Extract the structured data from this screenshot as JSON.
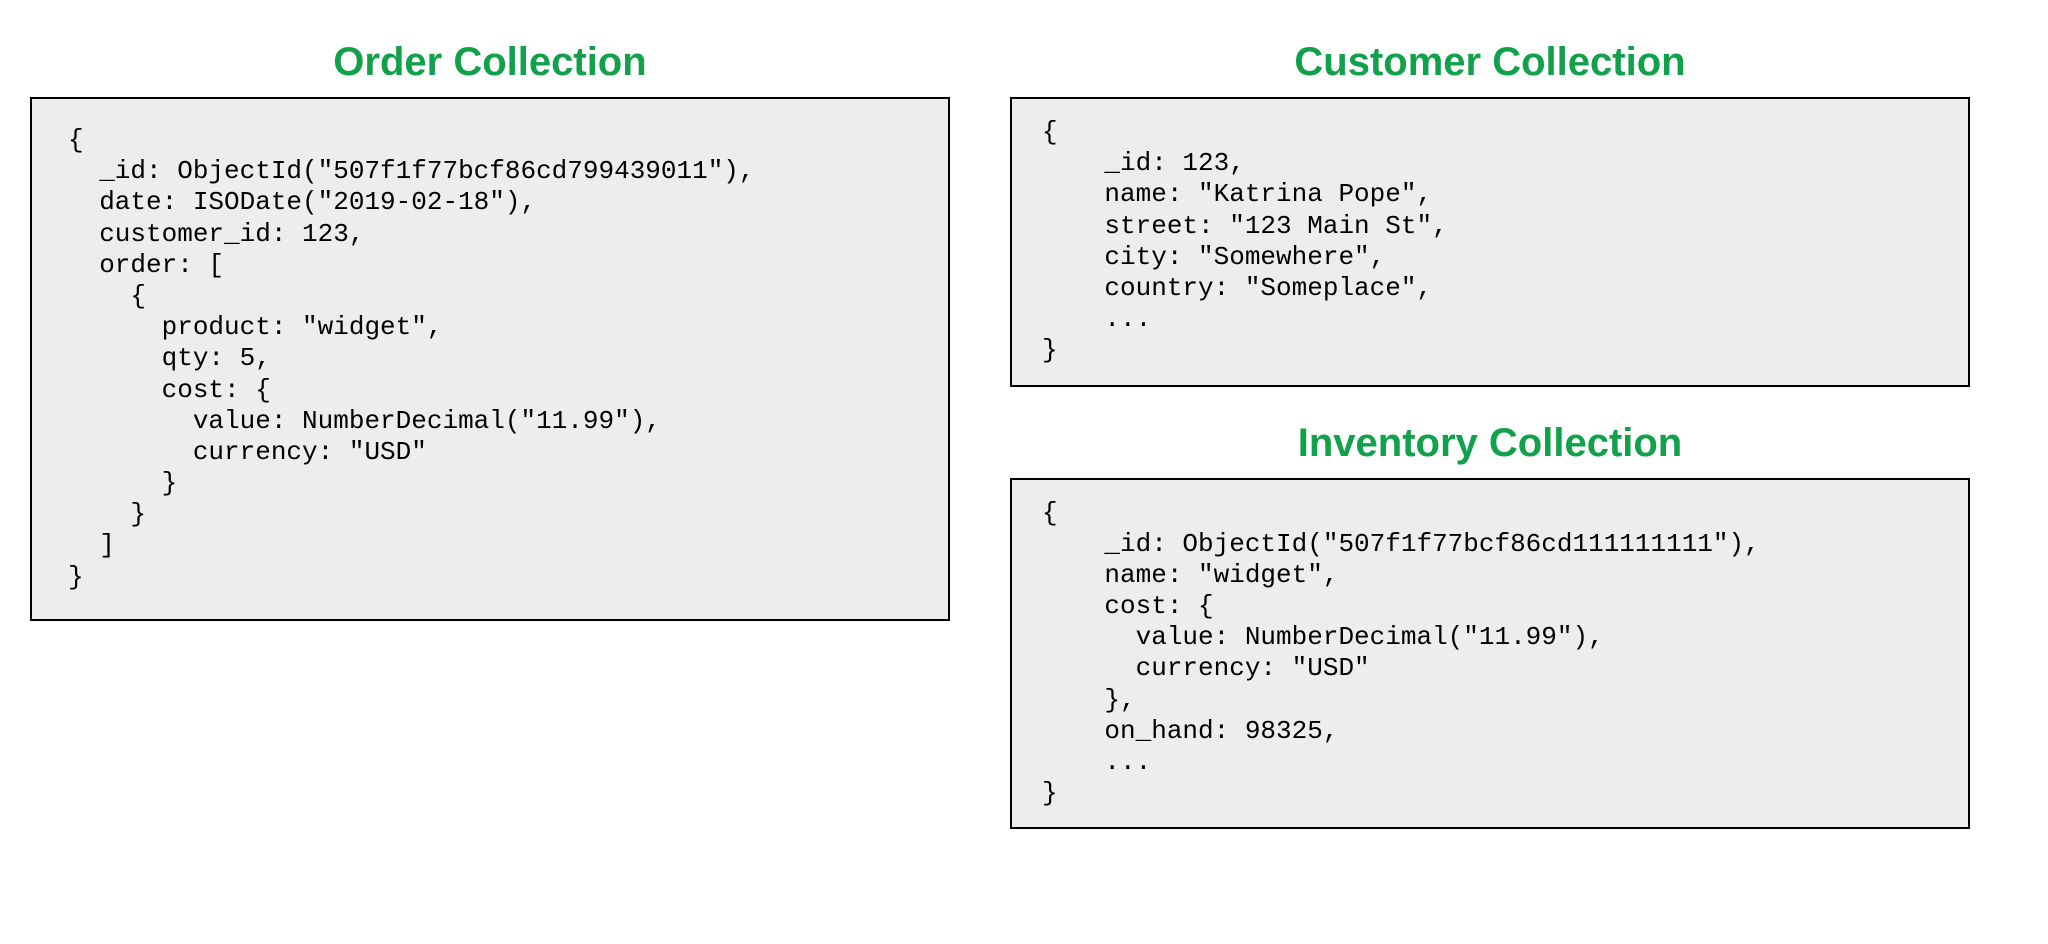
{
  "left": {
    "title": "Order Collection",
    "code": "{\n  _id: ObjectId(\"507f1f77bcf86cd799439011\"),\n  date: ISODate(\"2019-02-18\"),\n  customer_id: 123,\n  order: [\n    {\n      product: \"widget\",\n      qty: 5,\n      cost: {\n        value: NumberDecimal(\"11.99\"),\n        currency: \"USD\"\n      }\n    }\n  ]\n}"
  },
  "right": {
    "customer": {
      "title": "Customer Collection",
      "code": "{\n    _id: 123,\n    name: \"Katrina Pope\",\n    street: \"123 Main St\",\n    city: \"Somewhere\",\n    country: \"Someplace\",\n    ...\n}"
    },
    "inventory": {
      "title": "Inventory Collection",
      "code": "{\n    _id: ObjectId(\"507f1f77bcf86cd111111111\"),\n    name: \"widget\",\n    cost: {\n      value: NumberDecimal(\"11.99\"),\n      currency: \"USD\"\n    },\n    on_hand: 98325,\n    ...\n}"
    }
  }
}
